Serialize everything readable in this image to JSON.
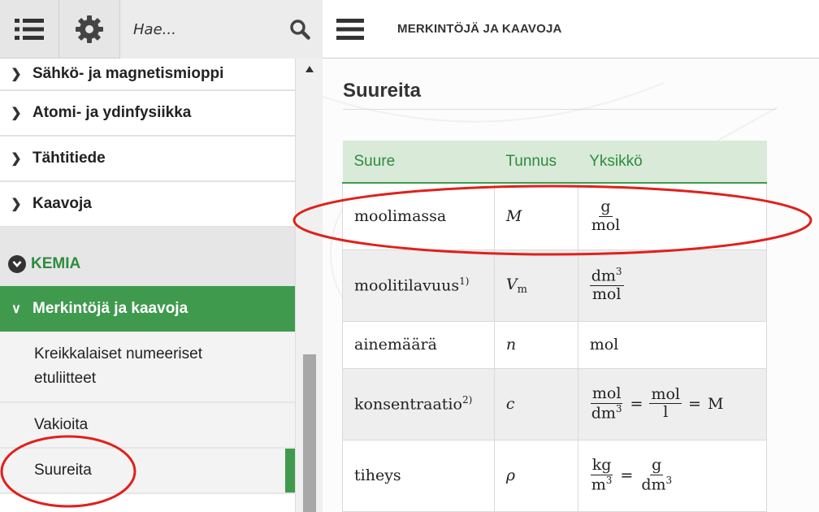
{
  "toolbar": {
    "search_placeholder": "Hae...",
    "breadcrumb_title": "MERKINTÖJÄ JA KAAVOJA"
  },
  "sidebar": {
    "items": [
      {
        "label": "Sähkö- ja magnetismioppi"
      },
      {
        "label": "Atomi- ja ydinfysiikka"
      },
      {
        "label": "Tähtitiede"
      },
      {
        "label": "Kaavoja"
      }
    ],
    "section_label": "KEMIA",
    "active_group": "Merkintöjä ja kaavoja",
    "sub_items": [
      {
        "label": "Kreikkalaiset numeeriset etuliitteet"
      },
      {
        "label": "Vakioita"
      },
      {
        "label": "Suureita"
      }
    ]
  },
  "main": {
    "page_title": "Suureita",
    "table": {
      "headers": [
        "Suure",
        "Tunnus",
        "Yksikkö"
      ],
      "rows": [
        {
          "quantity": "moolimassa",
          "symbol": "M",
          "unit_num": "g",
          "unit_den": "mol"
        },
        {
          "quantity": "moolitilavuus",
          "footnote": "1)",
          "symbol": "V",
          "symbol_sub": "m",
          "unit_num": "dm",
          "unit_num_sup": "3",
          "unit_den": "mol"
        },
        {
          "quantity": "ainemäärä",
          "symbol": "n",
          "unit": "mol"
        },
        {
          "quantity": "konsentraatio",
          "footnote": "2)",
          "symbol": "c",
          "unit_a_num": "mol",
          "unit_a_den": "dm",
          "unit_a_den_sup": "3",
          "eq1": "=",
          "unit_b_num": "mol",
          "unit_b_den": "l",
          "eq2": "=",
          "unit_c": "M"
        },
        {
          "quantity": "tiheys",
          "symbol": "ρ",
          "unit_a_num": "kg",
          "unit_a_den": "m",
          "unit_a_den_sup": "3",
          "eq1": "=",
          "unit_b_num": "g",
          "unit_b_den": "dm",
          "unit_b_den_sup": "3"
        }
      ]
    }
  },
  "colors": {
    "accent_green": "#3f9a4e",
    "header_green_bg": "#d9ead9",
    "annotation_red": "#e0201b"
  }
}
